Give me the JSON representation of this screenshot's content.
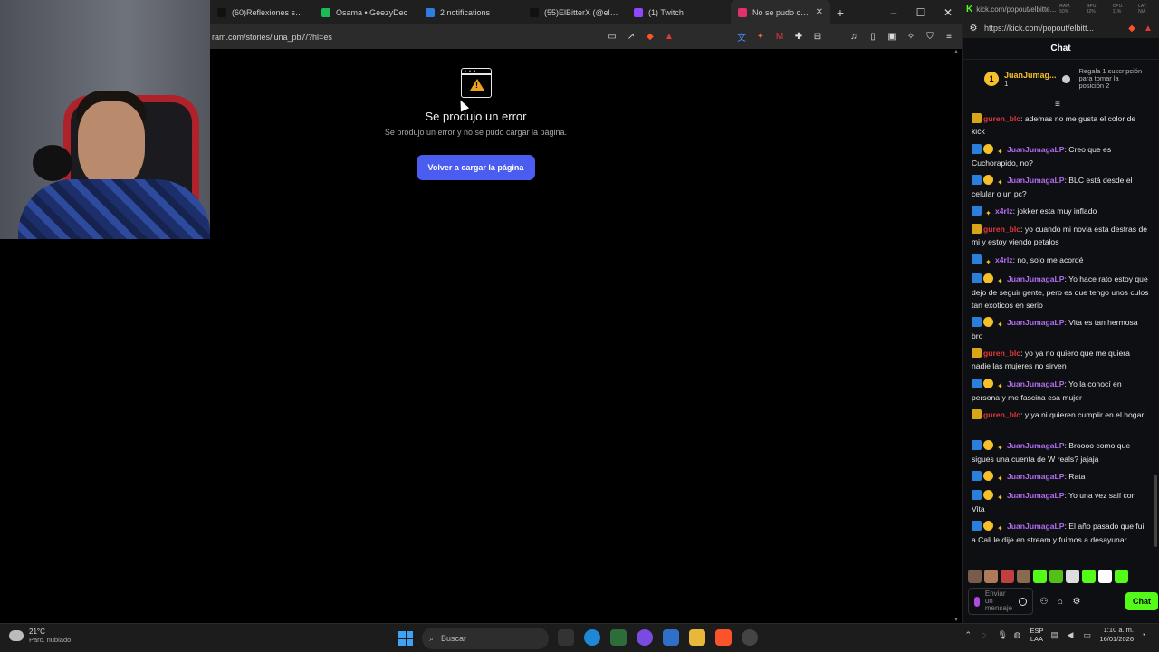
{
  "browser": {
    "tabs": [
      {
        "label": "(60)Reflexiones sobre e",
        "icon": "tiktok-icon",
        "color": "#111111"
      },
      {
        "label": "Osama • GeezyDec",
        "icon": "spotify-icon",
        "color": "#1db954"
      },
      {
        "label": "2 notifications",
        "icon": "notification-icon",
        "color": "#2f7de1"
      },
      {
        "label": "(55)ElBitterX (@elbitter",
        "icon": "tiktok-icon",
        "color": "#111111"
      },
      {
        "label": "(1) Twitch",
        "icon": "twitch-icon",
        "color": "#9146ff"
      },
      {
        "label": "No se pudo carga",
        "icon": "instagram-icon",
        "color": "#e1306c",
        "active": true
      }
    ],
    "url": "ram.com/stories/luna_pb7/?hl=es",
    "brave_badge": "1"
  },
  "error_page": {
    "title": "Se produjo un error",
    "subtitle": "Se produjo un error y no se pudo cargar la página.",
    "button": "Volver a cargar la página",
    "accent": "#4a5df0"
  },
  "chat": {
    "titlebar_url": "kick.com/popout/elbitte...",
    "meters": [
      "RAM: 50%",
      "GPU: 32%",
      "CPU: 11%",
      "LAT: N/A"
    ],
    "url": "https://kick.com/popout/elbitt...",
    "header": "Chat",
    "pinned": {
      "rank": "1",
      "name": "JuanJumag...",
      "count": "1",
      "text": "Regala 1 suscripción para tomar la posición 2"
    },
    "messages": [
      {
        "user": "guren_blc",
        "color": "red",
        "badges": [
          "crown"
        ],
        "text": ": ademas no me gusta el color de kick"
      },
      {
        "user": "JuanJumagaLP",
        "color": "purple",
        "badges": [
          "mod",
          "one",
          "sub"
        ],
        "text": ": Creo que es Cuchorapido, no?"
      },
      {
        "user": "JuanJumagaLP",
        "color": "purple",
        "badges": [
          "mod",
          "one",
          "sub"
        ],
        "text": ": BLC está desde el celular o un pc?"
      },
      {
        "user": "x4rlz",
        "color": "purple",
        "badges": [
          "mod",
          "sub"
        ],
        "text": ": jokker esta muy inflado"
      },
      {
        "user": "guren_blc",
        "color": "red",
        "badges": [
          "crown"
        ],
        "text": ": yo cuando mi novia esta destras de mi y estoy viendo petalos"
      },
      {
        "user": "x4rlz",
        "color": "purple",
        "badges": [
          "mod",
          "sub"
        ],
        "text": ": no, solo me acordé"
      },
      {
        "user": "JuanJumagaLP",
        "color": "purple",
        "badges": [
          "mod",
          "one",
          "sub"
        ],
        "text": ": Yo hace rato estoy que dejo de seguir gente, pero es que tengo unos culos tan exoticos en serio"
      },
      {
        "user": "JuanJumagaLP",
        "color": "purple",
        "badges": [
          "mod",
          "one",
          "sub"
        ],
        "text": ": Vita es tan hermosa bro"
      },
      {
        "user": "guren_blc",
        "color": "red",
        "badges": [
          "crown"
        ],
        "text": ": yo ya no quiero que me quiera nadie las mujeres no sirven"
      },
      {
        "user": "JuanJumagaLP",
        "color": "purple",
        "badges": [
          "mod",
          "one",
          "sub"
        ],
        "text": ": Yo la conocí en persona y me fascina esa mujer"
      },
      {
        "user": "guren_blc",
        "color": "red",
        "badges": [
          "crown"
        ],
        "text": ": y ya ni quieren cumplir en el hogar"
      },
      {
        "user": "JuanJumagaLP",
        "color": "purple",
        "badges": [
          "mod",
          "one",
          "sub"
        ],
        "text": ": Broooo como que sigues una cuenta de W reals? jajaja"
      },
      {
        "user": "JuanJumagaLP",
        "color": "purple",
        "badges": [
          "mod",
          "one",
          "sub"
        ],
        "text": ": Rata"
      },
      {
        "user": "JuanJumagaLP",
        "color": "purple",
        "badges": [
          "mod",
          "one",
          "sub"
        ],
        "text": ": Yo una vez salí con Vita"
      },
      {
        "user": "JuanJumagaLP",
        "color": "purple",
        "badges": [
          "mod",
          "one",
          "sub"
        ],
        "text": ": El año pasado que fui a Cali le dije en stream y fuimos a desayunar"
      }
    ],
    "input_placeholder": "Enviar un mensaje",
    "send_label": "Chat",
    "accent": "#53fc18"
  },
  "taskbar": {
    "temp": "21°C",
    "condition": "Parc. nublado",
    "search_placeholder": "Buscar",
    "lang1": "ESP",
    "lang2": "LAA",
    "time": "1:10 a. m.",
    "date": "16/01/2026"
  }
}
